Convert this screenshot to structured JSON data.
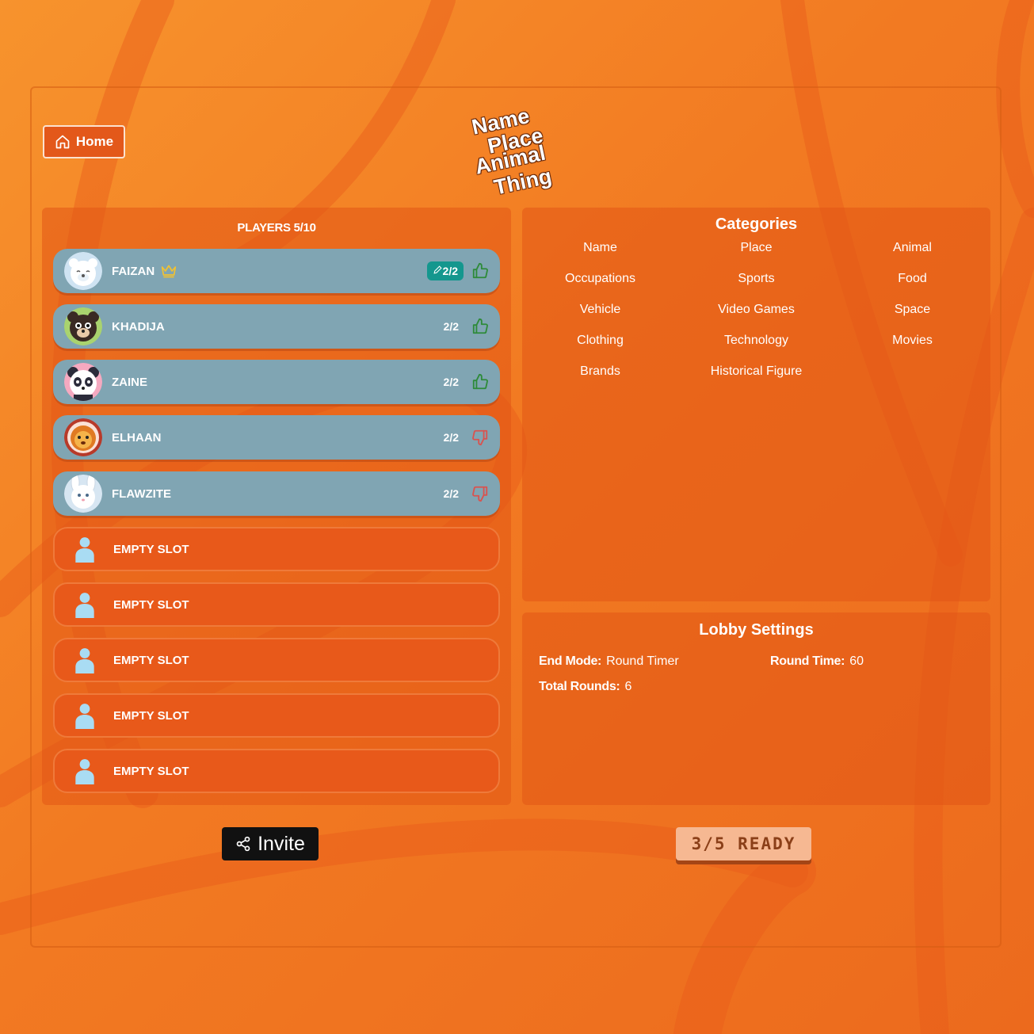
{
  "header": {
    "home_label": "Home",
    "logo_lines": [
      "Name",
      "Place",
      "Animal",
      "Thing"
    ]
  },
  "players": {
    "title": "PLAYERS 5/10",
    "list": [
      {
        "name": "FAIZAN",
        "score": "2/2",
        "host": true,
        "vote": "up",
        "avatar": "polar-bear"
      },
      {
        "name": "KHADIJA",
        "score": "2/2",
        "host": false,
        "vote": "up",
        "avatar": "black-bear"
      },
      {
        "name": "ZAINE",
        "score": "2/2",
        "host": false,
        "vote": "up",
        "avatar": "panda"
      },
      {
        "name": "ELHAAN",
        "score": "2/2",
        "host": false,
        "vote": "down",
        "avatar": "lion"
      },
      {
        "name": "FLAWZITE",
        "score": "2/2",
        "host": false,
        "vote": "down",
        "avatar": "bunny"
      }
    ],
    "empty_slots": [
      "EMPTY SLOT",
      "EMPTY SLOT",
      "EMPTY SLOT",
      "EMPTY SLOT",
      "EMPTY SLOT"
    ]
  },
  "categories": {
    "title": "Categories",
    "items": [
      "Name",
      "Place",
      "Animal",
      "Occupations",
      "Sports",
      "Food",
      "Vehicle",
      "Video Games",
      "Space",
      "Clothing",
      "Technology",
      "Movies",
      "Brands",
      "Historical Figure"
    ]
  },
  "lobby": {
    "title": "Lobby Settings",
    "end_mode_label": "End Mode:",
    "end_mode_value": "Round Timer",
    "round_time_label": "Round Time:",
    "round_time_value": "60",
    "total_rounds_label": "Total Rounds:",
    "total_rounds_value": "6"
  },
  "actions": {
    "invite_label": "Invite",
    "ready_label": "3/5 READY"
  },
  "colors": {
    "background": "#f27a22",
    "panel": "#e25616",
    "player_row": "#80a5b3",
    "accent_teal": "#14978e",
    "thumb_up": "#2e8b3a",
    "thumb_down": "#d9534f"
  }
}
